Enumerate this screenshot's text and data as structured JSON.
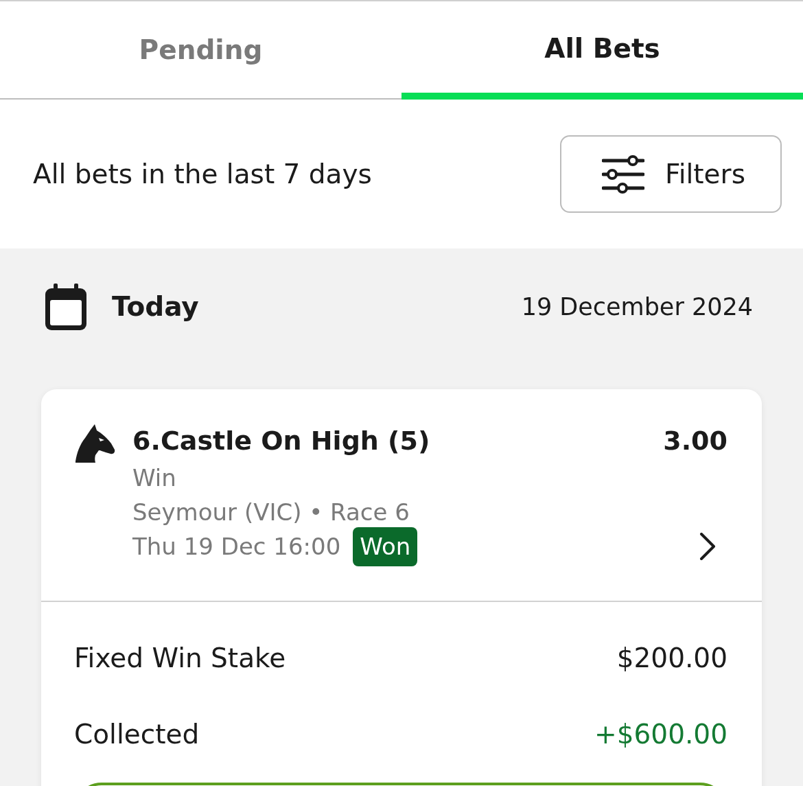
{
  "tabs": [
    {
      "label": "Pending",
      "selected": false
    },
    {
      "label": "All Bets",
      "selected": true
    }
  ],
  "header": {
    "title": "All bets in the last 7 days",
    "filters_button": "Filters"
  },
  "day_group": {
    "label": "Today",
    "date": "19 December 2024"
  },
  "bets": [
    {
      "selection": "6.Castle On High (5)",
      "odds": "3.00",
      "bet_type": "Win",
      "event": "Seymour (VIC) • Race 6",
      "start_time": "Thu 19 Dec 16:00",
      "result": {
        "label": "Won",
        "color": "#0b6a2b"
      },
      "rows": [
        {
          "label": "Fixed Win Stake",
          "value": "$200.00",
          "kind": "plain"
        },
        {
          "label": "Collected",
          "value": "+$600.00",
          "kind": "gain"
        }
      ],
      "action_button_shown": true
    }
  ]
}
